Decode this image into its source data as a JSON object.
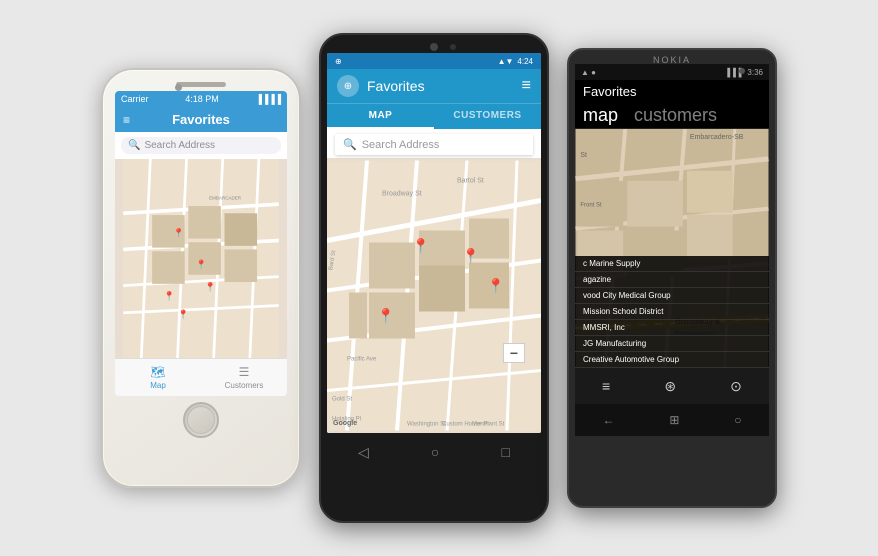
{
  "devices": {
    "ios": {
      "status": {
        "carrier": "Carrier",
        "wifi": "▼",
        "time": "4:18 PM",
        "battery": "▐▐▐▐"
      },
      "header": {
        "menu_icon": "≡",
        "title": "Favorites"
      },
      "search": {
        "placeholder": "Search Address",
        "icon": "🔍"
      },
      "tabs": [
        {
          "label": "Map",
          "icon": "🗺",
          "active": true
        },
        {
          "label": "Customers",
          "icon": "☰",
          "active": false
        }
      ]
    },
    "android": {
      "status": {
        "wifi": "▲▼",
        "time": "4:24",
        "battery": "▐▐▐"
      },
      "header": {
        "icon": "⊕",
        "title": "Favorites",
        "menu": "≡"
      },
      "tabs": [
        {
          "label": "MAP",
          "active": true
        },
        {
          "label": "CUSTOMERS",
          "active": false
        }
      ],
      "search": {
        "placeholder": "Search Address",
        "icon": "🔍"
      },
      "zoom": {
        "plus": "+",
        "minus": "−"
      },
      "google_label": "Google",
      "nav": [
        "◁",
        "○",
        "□"
      ]
    },
    "nokia": {
      "brand": "NOKIA",
      "status": {
        "icons": "▲ ●",
        "bars": "▐▐▐",
        "time": "3:36"
      },
      "title": "Favorites",
      "tabs": [
        {
          "label": "map",
          "active": true
        },
        {
          "label": "customers",
          "active": false
        }
      ],
      "list_items": [
        "c Marine Supply",
        "agazine",
        "vood City Medical Group",
        "Mission School District",
        "MMSRI, Inc",
        "JG Manufacturing",
        "Creative Automotive Group"
      ],
      "bottom_icons": [
        "≡",
        "⊛",
        "⊙"
      ],
      "win_nav": [
        "←",
        "⊞",
        "○"
      ]
    }
  }
}
